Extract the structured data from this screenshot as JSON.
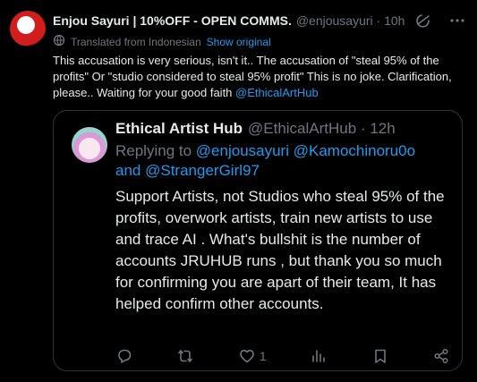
{
  "tweet": {
    "author": {
      "display_name": "Enjou Sayuri | 10%OFF - OPEN COMMS.",
      "handle": "@enjousayuri",
      "time": "10h"
    },
    "translation": {
      "label": "Translated from Indonesian",
      "link": "Show original"
    },
    "text": "This accusation is very serious, isn't it.. The accusation of \"steal 95% of the profits\" Or \"studio considered to steal 95% profit\" This is no joke. Clarification, please.. Waiting for your good faith",
    "mention": "@EthicalArtHub"
  },
  "quote": {
    "author": {
      "display_name": "Ethical Artist Hub",
      "handle": "@EthicalArtHub",
      "time": "12h"
    },
    "replying_prefix": "Replying to",
    "replying_mentions": [
      "@enjousayuri",
      "@Kamochinoru0o",
      "@StrangerGirl97"
    ],
    "replying_and": "and",
    "body": "Support Artists, not Studios who steal 95% of the profits, overwork artists, train new artists to use and trace AI . What's bullshit is the number of accounts JRUHUB runs , but thank you so much for confirming you are apart of their team, It has helped confirm other accounts.",
    "actions": {
      "like_count": "1"
    }
  },
  "icons": {
    "header": [
      "grok-icon",
      "more-icon"
    ],
    "translate": "globe-icon",
    "actions": [
      "reply-icon",
      "repost-icon",
      "like-icon",
      "views-icon",
      "bookmark-icon",
      "share-icon"
    ]
  },
  "colors": {
    "background": "#000000",
    "text": "#e7e9ea",
    "muted": "#71767b",
    "link": "#1d9bf0",
    "border": "#2f3336"
  }
}
